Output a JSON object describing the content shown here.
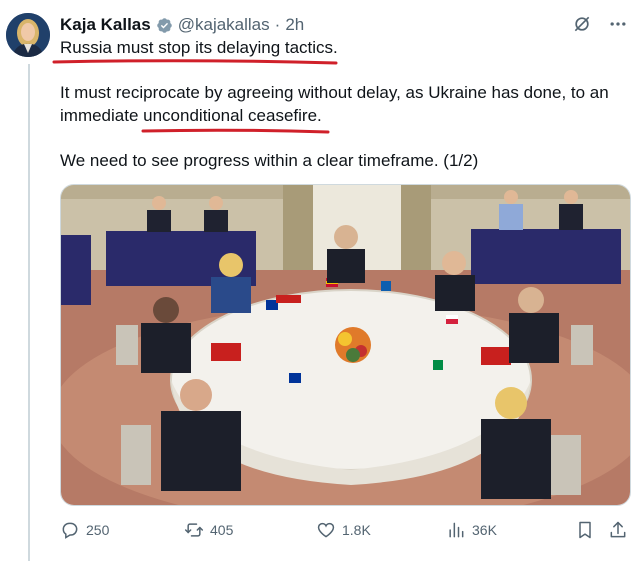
{
  "author": {
    "name": "Kaja Kallas",
    "handle": "@kajakallas",
    "separator": "·",
    "time": "2h",
    "verified_color": "#829aab"
  },
  "tweet": {
    "p1": "Russia must stop its delaying tactics.",
    "p2a": "It must reciprocate by agreeing without delay, as Ukraine has done, to an immediate ",
    "p2b": "unconditional ceasefire",
    "p2c": ".",
    "p3": "We need to see progress within a clear timeframe. (1/2)",
    "highlight_color": "#d0202a"
  },
  "actions": {
    "replies": "250",
    "reposts": "405",
    "likes": "1.8K",
    "views": "36K"
  },
  "icons": [
    "grok-icon",
    "more-icon",
    "reply-icon",
    "repost-icon",
    "like-icon",
    "views-icon",
    "bookmark-icon",
    "share-icon",
    "verified-icon"
  ]
}
